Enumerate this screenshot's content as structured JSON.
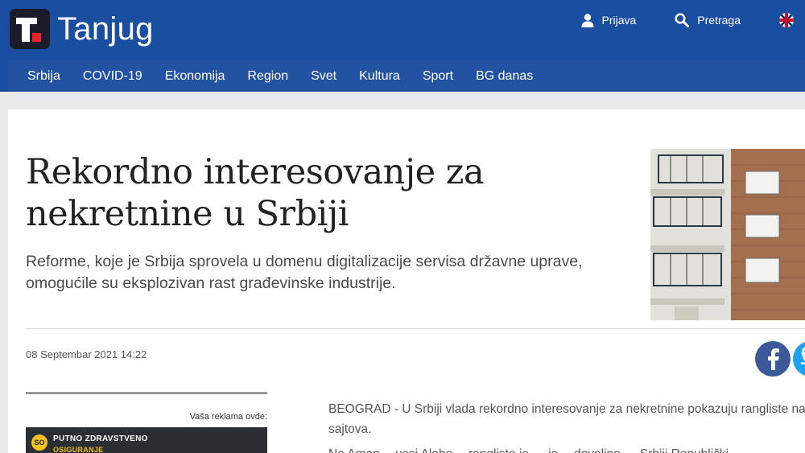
{
  "header": {
    "logo_text": "Tanjug",
    "login_label": "Prijava",
    "search_label": "Pretraga"
  },
  "nav": {
    "items": [
      "Srbija",
      "COVID-19",
      "Ekonomija",
      "Region",
      "Svet",
      "Kultura",
      "Sport",
      "BG danas"
    ]
  },
  "article": {
    "title": "Rekordno interesovanje za nekretnine u Srbiji",
    "lead": "Reforme, koje je Srbija sprovela u domenu digitalizacije servisa državne uprave, omogućile su eksplozivan rast građevinske industrije.",
    "date": "08 Septembar 2021 14:22",
    "body_p1": "BEOGRAD - U Srbiji vlada rekordno interesovanje za nekretnine pokazuju rangliste naj",
    "body_p1_cont": "sajtova.",
    "body_p2": "Na Aman… vesi Alabo… rangliste je … je… dovoljno … Srbiji Republički"
  },
  "ad": {
    "label": "Vaša reklama ovde:",
    "title": "PUTNO ZDRAVSTVENO",
    "subtitle": "OSIGURANJE",
    "badge": "SO"
  },
  "colors": {
    "brand_blue": "#1a4ea1",
    "facebook": "#3b5998",
    "twitter": "#1da1f2"
  }
}
